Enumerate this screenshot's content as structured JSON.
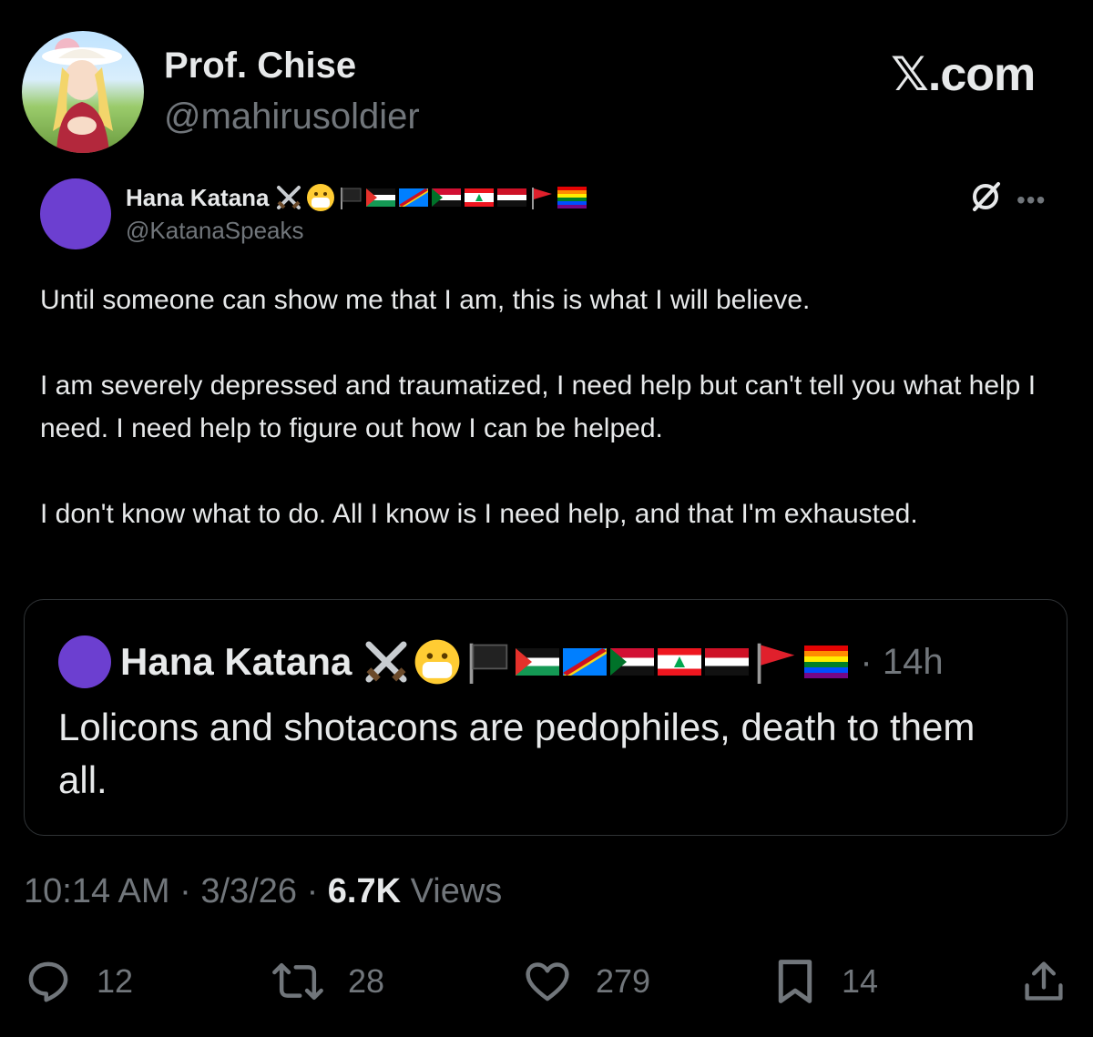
{
  "author": {
    "display_name": "Prof. Chise",
    "handle": "@mahirusoldier"
  },
  "brand": "𝕏.com",
  "embedded_post": {
    "display_name": "Hana Katana",
    "name_emojis": [
      "crossed-swords",
      "face-with-medical-mask",
      "black-flag",
      "flag-palestine",
      "flag-dr-congo",
      "flag-sudan",
      "flag-lebanon",
      "flag-yemen",
      "triangular-red-flag",
      "rainbow-flag"
    ],
    "handle": "@KatanaSpeaks",
    "text": "Until someone can show me that I am, this is what I will believe.\n\nI am severely depressed and traumatized, I need help but can't tell you what help I need. I need help to figure out how I can be helped.\n\nI don't know what to do. All I know is I need help, and that I'm exhausted."
  },
  "quoted_post": {
    "display_name": "Hana Katana",
    "time": "· 14h",
    "text": "Lolicons and shotacons are pedophiles, death to them all."
  },
  "meta": {
    "time": "10:14 AM",
    "sep1": "·",
    "date": "3/3/26",
    "sep2": "·",
    "views_count": "6.7K",
    "views_label": "Views"
  },
  "actions": {
    "replies": "12",
    "reposts": "28",
    "likes": "279",
    "bookmarks": "14"
  },
  "colors": {
    "background": "#000000",
    "primary_text": "#e7e9ea",
    "secondary_text": "#71767b",
    "border": "#2f3336",
    "avatar_purple": "#6c3fd0"
  }
}
